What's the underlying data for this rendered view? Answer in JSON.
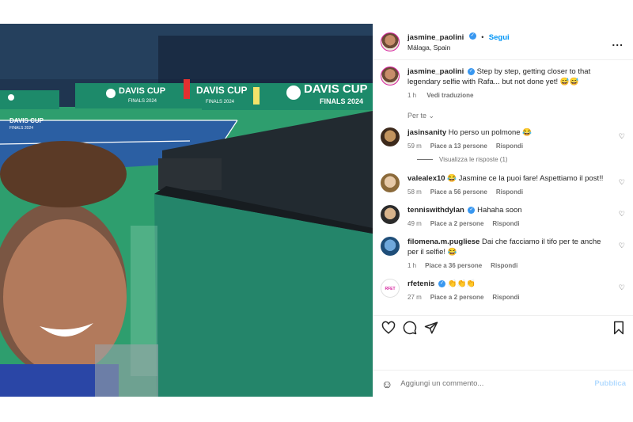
{
  "post": {
    "author": "jasmine_paolini",
    "follow_label": "Segui",
    "location": "Málaga, Spain",
    "more_label": "..."
  },
  "caption": {
    "author": "jasmine_paolini",
    "text": "Step by step, getting closer to that legendary selfie with Rafa... but not done yet! 😅😅",
    "time": "1 h",
    "translate": "Vedi traduzione"
  },
  "photo": {
    "banner_left": "DAVIS CUP",
    "banner_left_sub": "FINALS 2024",
    "banner_mid": "DAVIS CUP",
    "banner_mid_sub": "FINALS 2024",
    "banner_right": "DAVIS CUP",
    "banner_right_sub": "FINALS 2024",
    "small_left": "DAVIS CUP",
    "small_left_sub": "FINALS 2024"
  },
  "for_you": "Per te",
  "comments": [
    {
      "user": "jasinsanity",
      "verified": false,
      "text": "Ho perso un polmone 😂",
      "time": "59 m",
      "likes": "Piace a 13 persone",
      "reply": "Rispondi"
    },
    {
      "user": "valealex10",
      "verified": false,
      "text": "😂 Jasmine ce la puoi fare! Aspettiamo il post!!",
      "time": "58 m",
      "likes": "Piace a 56 persone",
      "reply": "Rispondi"
    },
    {
      "user": "tenniswithdylan",
      "verified": true,
      "text": "Hahaha soon",
      "time": "49 m",
      "likes": "Piace a 2 persone",
      "reply": "Rispondi"
    },
    {
      "user": "filomena.m.pugliese",
      "verified": false,
      "text": "Dai che facciamo il tifo per te anche per il selfie! 😂",
      "time": "1 h",
      "likes": "Piace a 36 persone",
      "reply": "Rispondi"
    },
    {
      "user": "rfetenis",
      "verified": true,
      "text": "👏👏👏",
      "time": "27 m",
      "likes": "Piace a 2 persone",
      "reply": "Rispondi"
    }
  ],
  "view_replies": "Visualizza le risposte (1)",
  "add_comment": {
    "placeholder": "Aggiungi un commento...",
    "publish": "Pubblica"
  },
  "colors": {
    "link_blue": "#0095f6",
    "verified_blue": "#3897f0",
    "court_green": "#2e9e6e",
    "court_blue": "#2b5fa3"
  }
}
